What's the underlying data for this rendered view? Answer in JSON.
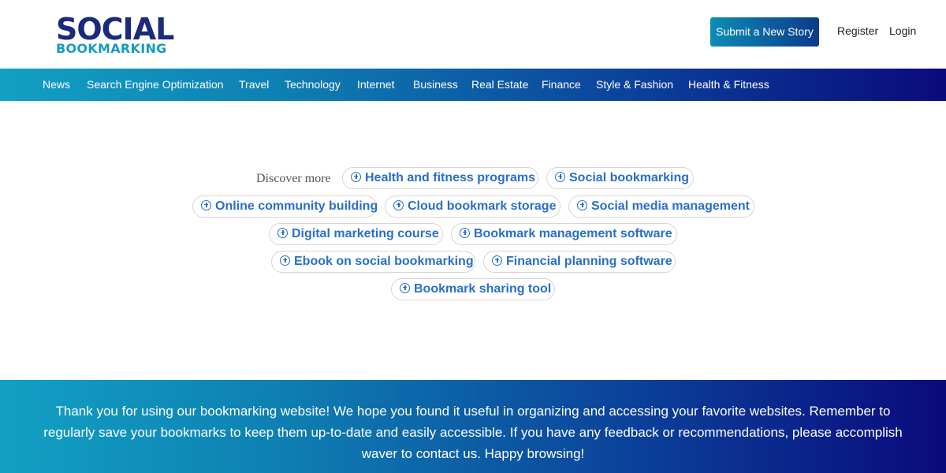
{
  "header": {
    "logo_top": "SOCIAL",
    "logo_bottom": "BOOKMARKING",
    "submit_label": "Submit a New Story",
    "register_label": "Register",
    "login_label": "Login"
  },
  "nav": {
    "items": [
      "News",
      "Search Engine Optimization",
      "Travel",
      "Technology",
      "Internet",
      "Business",
      "Real Estate",
      "Finance",
      "Style & Fashion",
      "Health & Fitness"
    ]
  },
  "discover": {
    "label": "Discover more",
    "chips": [
      "Health and fitness programs",
      "Social bookmarking",
      "Online community building",
      "Cloud bookmark storage",
      "Social media management",
      "Digital marketing course",
      "Bookmark management software",
      "Ebook on social bookmarking",
      "Financial planning software",
      "Bookmark sharing tool"
    ]
  },
  "footer": {
    "text": "Thank you for using our bookmarking website! We hope you found it useful in organizing and accessing your favorite websites. Remember to regularly save your bookmarks to keep them up-to-date and easily accessible. If you have any feedback or recommendations, please accomplish waver to contact us. Happy browsing!"
  },
  "colors": {
    "brand_dark": "#1b2a7a",
    "brand_light": "#169ac0",
    "chip_text": "#2a6fc8"
  }
}
